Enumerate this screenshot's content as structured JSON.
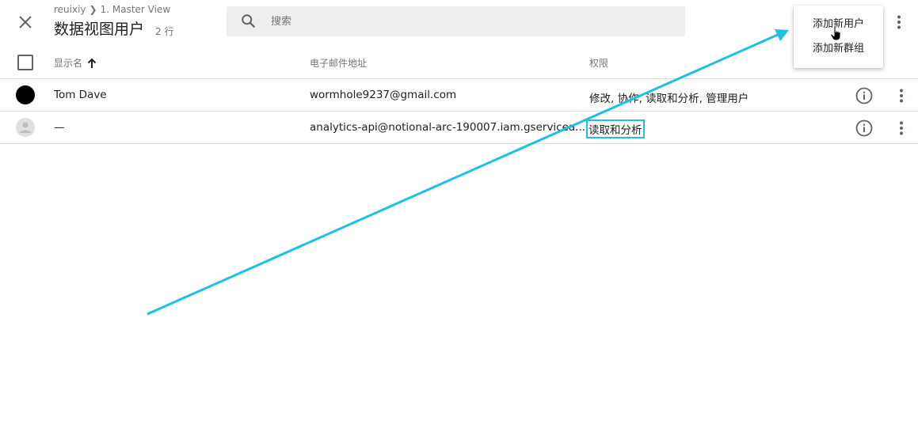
{
  "header": {
    "close_icon": "close-icon",
    "breadcrumb": {
      "account": "reuixiy",
      "separator": "❯",
      "view": "1. Master View"
    },
    "title": "数据视图用户",
    "row_count": "2 行"
  },
  "search": {
    "placeholder": "搜索",
    "value": "",
    "icon": "search-icon"
  },
  "menu": {
    "items": [
      {
        "label": "添加新用户"
      },
      {
        "label": "添加新群组"
      }
    ]
  },
  "table": {
    "columns": {
      "name": "显示名",
      "email": "电子邮件地址",
      "permissions": "权限"
    },
    "sort_icon": "arrow-up-icon",
    "rows": [
      {
        "name": "Tom Dave",
        "email": "wormhole9237@gmail.com",
        "permissions": "修改, 协作, 读取和分析, 管理用户"
      },
      {
        "name": "—",
        "email": "analytics-api@notional-arc-190007.iam.gserviceaccount.com",
        "email_display": "analytics-api@notional-arc-190007.iam.gservicea...",
        "permissions": "读取和分析"
      }
    ]
  },
  "colors": {
    "accent": "#1fc0e6",
    "search_bg": "#eeeeee",
    "divider": "#e0e0e0"
  }
}
